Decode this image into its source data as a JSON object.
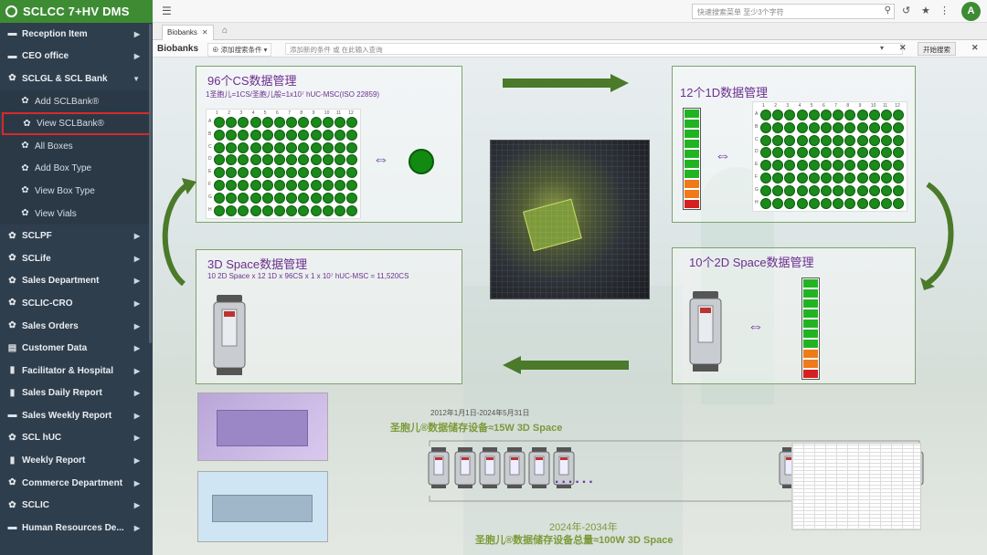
{
  "app": {
    "title": "SCLCC 7+HV DMS",
    "avatar_letter": "A"
  },
  "sidebar": {
    "items": [
      {
        "label": "Reception Item",
        "icon": "folder-icon"
      },
      {
        "label": "CEO office",
        "icon": "folder-icon"
      },
      {
        "label": "SCLGL & SCL Bank",
        "icon": "gear-icon"
      },
      {
        "label": "Add SCLBank®",
        "icon": "gear-icon"
      },
      {
        "label": "View SCLBank®",
        "icon": "gear-icon"
      },
      {
        "label": "All Boxes",
        "icon": "gear-icon"
      },
      {
        "label": "Add Box Type",
        "icon": "gear-icon"
      },
      {
        "label": "View Box Type",
        "icon": "gear-icon"
      },
      {
        "label": "View Vials",
        "icon": "gear-icon"
      },
      {
        "label": "SCLPF",
        "icon": "gear-icon"
      },
      {
        "label": "SCLife",
        "icon": "gear-icon"
      },
      {
        "label": "Sales Department",
        "icon": "gear-icon"
      },
      {
        "label": "SCLIC-CRO",
        "icon": "gear-icon"
      },
      {
        "label": "Sales Orders",
        "icon": "gear-icon"
      },
      {
        "label": "Customer Data",
        "icon": "database-icon"
      },
      {
        "label": "Facilitator & Hospital",
        "icon": "file-icon"
      },
      {
        "label": "Sales Daily Report",
        "icon": "file-icon"
      },
      {
        "label": "Sales Weekly Report",
        "icon": "folder-icon"
      },
      {
        "label": "SCL hUC",
        "icon": "gear-icon"
      },
      {
        "label": "Weekly Report",
        "icon": "file-icon"
      },
      {
        "label": "Commerce Department",
        "icon": "gear-icon"
      },
      {
        "label": "SCLIC",
        "icon": "gear-icon"
      },
      {
        "label": "Human Resources De...",
        "icon": "folder-icon"
      }
    ]
  },
  "topbar": {
    "search_placeholder": "快速搜索菜单 至少3个字符"
  },
  "tabs": [
    {
      "label": "Biobanks"
    }
  ],
  "filter": {
    "title": "Biobanks",
    "add_condition": "添加搜索条件",
    "condition_placeholder": "添加新的条件 或 在此输入查询",
    "start_search": "开始搜索"
  },
  "diagram": {
    "cs_title": "96个CS数据管理",
    "cs_sub": "1圣胞儿=1CS/圣胞儿般=1x10⁷ hUC-MSC(ISO 22859)",
    "d1_title": "12个1D数据管理",
    "d2_title": "10个2D Space数据管理",
    "d3_title": "3D Space数据管理",
    "d3_sub": "10 2D Space x 12 1D x 96CS x 1 x 10⁷ hUC-MSC = 11,520CS",
    "period1": "2012年1月1日-2024年5月31日",
    "period1_total": "圣胞儿®数据储存设备≈15W 3D Space",
    "period2": "2024年-2034年",
    "period2_total": "圣胞儿®数据储存设备总量≈100W 3D Space",
    "ellipsis": "......",
    "plate_cols": [
      "1",
      "2",
      "3",
      "4",
      "5",
      "6",
      "7",
      "8",
      "9",
      "10",
      "11",
      "12"
    ],
    "plate_rows": [
      "A",
      "B",
      "C",
      "D",
      "E",
      "F",
      "G",
      "H"
    ],
    "color_well": "#1a8a1a",
    "color_title": "#6b2f8e",
    "color_border": "#7ea36d"
  }
}
